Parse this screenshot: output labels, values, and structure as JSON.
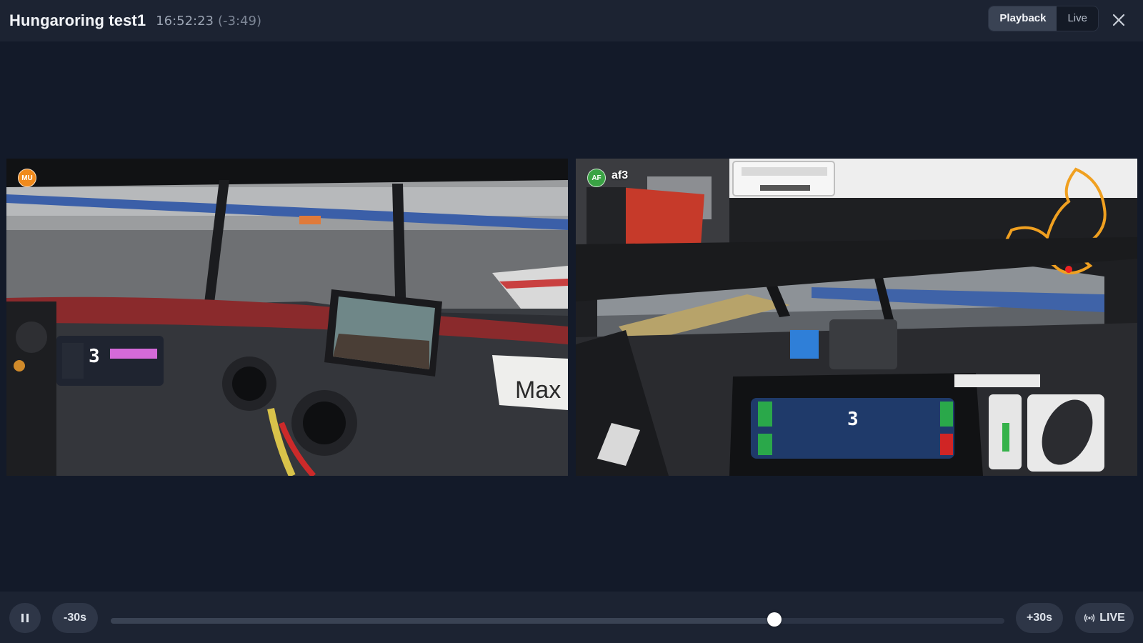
{
  "header": {
    "title": "Hungaroring test1",
    "time": "16:52:23",
    "offset": "(-3:49)",
    "modes": [
      {
        "label": "Playback",
        "active": true
      },
      {
        "label": "Live",
        "active": false
      }
    ],
    "close_icon": "close-icon"
  },
  "streams": [
    {
      "badge": "MU",
      "name": "",
      "badge_color": "#f08a1c",
      "gear": "3",
      "sticker_text": "Max"
    },
    {
      "badge": "AF",
      "name": "af3",
      "badge_color": "#3aa344",
      "gear": "3"
    }
  ],
  "controls": {
    "pause_icon": "pause-icon",
    "back_label": "-30s",
    "forward_label": "+30s",
    "live_label": "LIVE",
    "live_icon": "broadcast-icon",
    "progress": 0.743
  },
  "colors": {
    "accent_orange": "#f08a1c",
    "accent_green": "#3aa344",
    "background": "#131a29",
    "bar": "#1c2332"
  }
}
